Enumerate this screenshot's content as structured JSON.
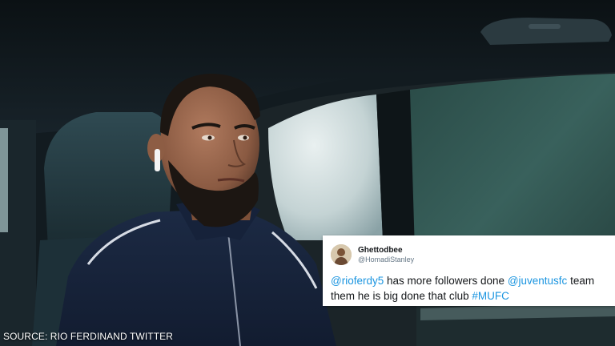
{
  "tweet": {
    "display_name": "Ghettodbee",
    "handle": "@HomadiStanley",
    "mention1": "@rioferdy5",
    "text1": " has more followers done ",
    "mention2": "@juventusfc",
    "text2": " team",
    "text3": "them he is big done that club ",
    "hashtag": "#MUFC"
  },
  "caption": "SOURCE: RIO FERDINAND TWITTER"
}
